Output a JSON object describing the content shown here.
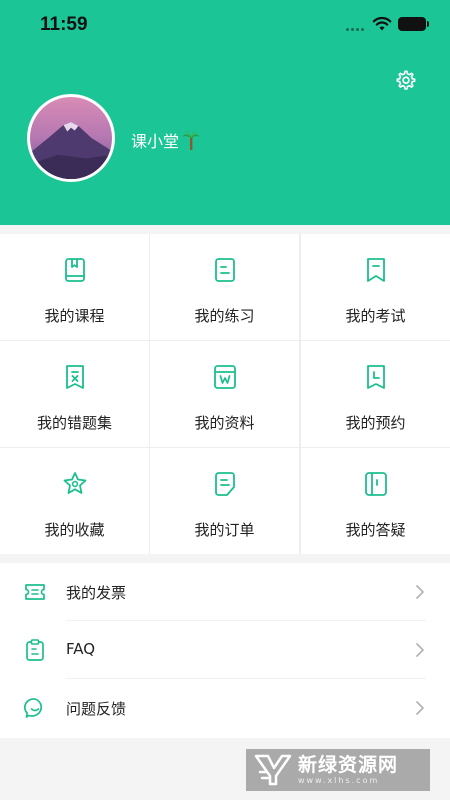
{
  "status_bar": {
    "time": "11:59"
  },
  "profile": {
    "username": "课小堂"
  },
  "grid": [
    {
      "label": "我的课程",
      "icon": "book-icon"
    },
    {
      "label": "我的练习",
      "icon": "exercise-icon"
    },
    {
      "label": "我的考试",
      "icon": "exam-bookmark-icon"
    },
    {
      "label": "我的错题集",
      "icon": "wrong-questions-icon"
    },
    {
      "label": "我的资料",
      "icon": "materials-icon"
    },
    {
      "label": "我的预约",
      "icon": "appointment-icon"
    },
    {
      "label": "我的收藏",
      "icon": "star-icon"
    },
    {
      "label": "我的订单",
      "icon": "order-icon"
    },
    {
      "label": "我的答疑",
      "icon": "qa-icon"
    }
  ],
  "list": [
    {
      "label": "我的发票",
      "icon": "invoice-icon"
    },
    {
      "label": "FAQ",
      "icon": "clipboard-icon"
    },
    {
      "label": "问题反馈",
      "icon": "feedback-icon"
    }
  ],
  "watermark": {
    "cn": "新绿资源网",
    "en": "www.xlhs.com"
  },
  "colors": {
    "accent": "#1cc595",
    "icon_stroke": "#1cbf8e"
  }
}
